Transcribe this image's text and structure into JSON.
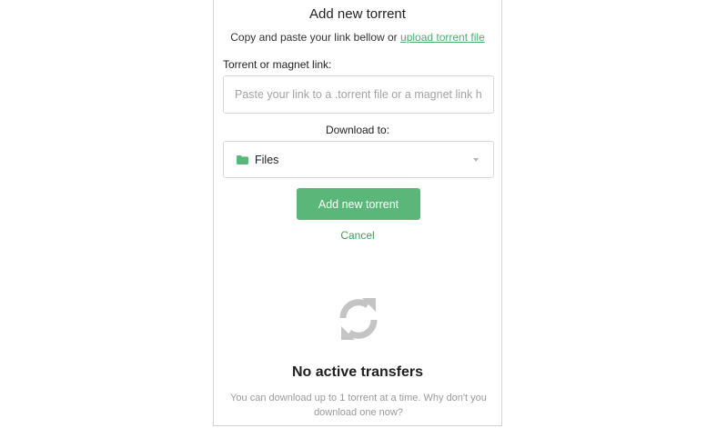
{
  "dialog": {
    "title": "Add new torrent",
    "subtitle_text": "Copy and paste your link bellow or ",
    "upload_link": "upload torrent file",
    "link_field_label": "Torrent or magnet link:",
    "link_field_placeholder": "Paste your link to a .torrent file or a magnet link here",
    "link_field_value": "",
    "download_label": "Download to:",
    "download_selected": "Files",
    "download_icon": "folder-icon",
    "add_button": "Add new torrent",
    "cancel": "Cancel"
  },
  "empty_state": {
    "icon": "sync-icon",
    "title": "No active transfers",
    "description": "You can download up to 1 torrent at a time. Why don't you download one now?"
  },
  "colors": {
    "accent": "#5bb679",
    "link": "#4caf6a",
    "icon_muted": "#c4c4c4"
  }
}
